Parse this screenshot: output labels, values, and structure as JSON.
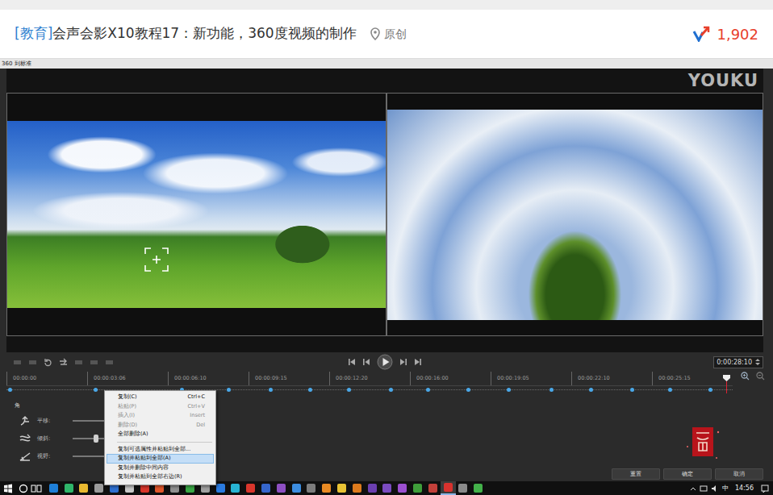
{
  "page": {
    "tag": "[教育]",
    "title": "会声会影X10教程17：新功能，360度视频的制作",
    "origin": "原创",
    "views": "1,902"
  },
  "window": {
    "title": "360 到标准",
    "watermark": "YOUKU"
  },
  "player": {
    "timecode": "0:00:28:10"
  },
  "timeline": {
    "ticks": [
      "00:00:00",
      "00:00:03:06",
      "00:00:06:10",
      "00:00:09:15",
      "00:00:12:20",
      "00:00:16:00",
      "00:00:19:05",
      "00:00:22:10",
      "00:00:25:15"
    ],
    "playhead": {
      "level": 0.991
    },
    "keyframes": [
      {
        "level": 0.004
      },
      {
        "level": 0.122
      },
      {
        "level": 0.241
      },
      {
        "level": 0.306
      },
      {
        "level": 0.363
      },
      {
        "level": 0.418
      },
      {
        "level": 0.471
      },
      {
        "level": 0.529
      },
      {
        "level": 0.58
      },
      {
        "level": 0.636
      },
      {
        "level": 0.691
      },
      {
        "level": 0.75
      },
      {
        "level": 0.804
      },
      {
        "level": 0.861
      },
      {
        "level": 0.913
      },
      {
        "level": 0.969
      }
    ]
  },
  "angle": {
    "label": "角",
    "controls": [
      {
        "label": "平移:",
        "level": 0.5
      },
      {
        "label": "倾斜:",
        "level": 0.18
      },
      {
        "label": "视野:",
        "level": 0.5
      }
    ]
  },
  "context_menu": {
    "groups": [
      [
        {
          "label": "复制(C)",
          "shortcut": "Ctrl+C",
          "disabled": false,
          "selected": false
        },
        {
          "label": "粘贴(P)",
          "shortcut": "Ctrl+V",
          "disabled": true,
          "selected": false
        },
        {
          "label": "插入(I)",
          "shortcut": "Insert",
          "disabled": true,
          "selected": false
        },
        {
          "label": "删除(D)",
          "shortcut": "Del",
          "disabled": true,
          "selected": false
        },
        {
          "label": "全部删除(A)",
          "shortcut": "",
          "disabled": false,
          "selected": false
        }
      ],
      [
        {
          "label": "复制可选属性并粘贴到全部...",
          "shortcut": "",
          "disabled": false,
          "selected": false
        },
        {
          "label": "复制并粘贴到全部(A)",
          "shortcut": "",
          "disabled": false,
          "selected": true
        },
        {
          "label": "复制并删除中间内容",
          "shortcut": "",
          "disabled": false,
          "selected": false
        },
        {
          "label": "复制并粘贴到全部右边(R)",
          "shortcut": "",
          "disabled": false,
          "selected": false
        }
      ]
    ]
  },
  "buttons": [
    {
      "label": "重置"
    },
    {
      "label": "确定"
    },
    {
      "label": "取消"
    }
  ],
  "taskbar": {
    "apps": [
      {
        "color": "#1e7fd8",
        "selected": false
      },
      {
        "color": "#2fb56a",
        "selected": false
      },
      {
        "color": "#e9b930",
        "selected": false
      },
      {
        "color": "#9a9a9a",
        "selected": false
      },
      {
        "color": "#2d6fd0",
        "selected": false
      },
      {
        "color": "#c8c8c8",
        "selected": false
      },
      {
        "color": "#d8352a",
        "selected": false
      },
      {
        "color": "#e2572b",
        "selected": false
      },
      {
        "color": "#8f8f8f",
        "selected": false
      },
      {
        "color": "#3aa845",
        "selected": false
      },
      {
        "color": "#a0a0a0",
        "selected": false
      },
      {
        "color": "#2a7be0",
        "selected": false
      },
      {
        "color": "#27b3d3",
        "selected": false
      },
      {
        "color": "#d9362c",
        "selected": false
      },
      {
        "color": "#3566cc",
        "selected": false
      },
      {
        "color": "#8d4fc2",
        "selected": false
      },
      {
        "color": "#3c8de0",
        "selected": false
      },
      {
        "color": "#7c7c7c",
        "selected": false
      },
      {
        "color": "#e98a23",
        "selected": false
      },
      {
        "color": "#e8c234",
        "selected": false
      },
      {
        "color": "#dd7a1c",
        "selected": false
      },
      {
        "color": "#6b3fb0",
        "selected": false
      },
      {
        "color": "#7a4bc0",
        "selected": false
      },
      {
        "color": "#9b4fd0",
        "selected": false
      },
      {
        "color": "#3f9e3a",
        "selected": false
      },
      {
        "color": "#c2403a",
        "selected": false
      },
      {
        "color": "#d8322e",
        "selected": true
      },
      {
        "color": "#8a8a8a",
        "selected": false
      },
      {
        "color": "#43b14a",
        "selected": false
      }
    ],
    "ime": "中",
    "clock": "14:56"
  }
}
